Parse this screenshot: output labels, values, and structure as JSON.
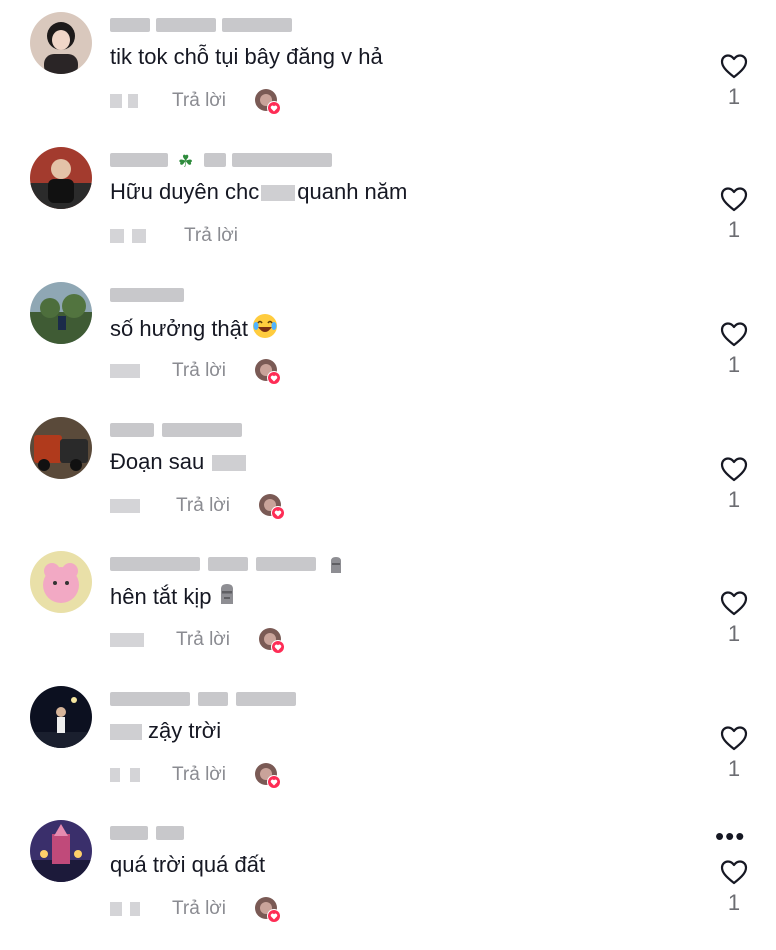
{
  "reply_label": "Trả lời",
  "comments": [
    {
      "text": "tik tok chỗ tụi bây đăng v hả",
      "likes": "1"
    },
    {
      "text_before": "Hữu duyên chc",
      "text_after": "quanh năm",
      "likes": "1"
    },
    {
      "text": "số hưởng thật",
      "likes": "1"
    },
    {
      "text": "Đoạn sau",
      "likes": "1"
    },
    {
      "text": "hên tắt kịp",
      "likes": "1"
    },
    {
      "text": "zậy trời",
      "likes": "1"
    },
    {
      "text": "quá trời quá đất",
      "likes": "1"
    }
  ],
  "colors": {
    "text": "#161823",
    "muted": "#8a8b91",
    "heart_badge": "#fe2c55"
  },
  "icons": [
    "heart-outline-icon",
    "creator-liked-badge-icon",
    "more-options-icon",
    "laughing-emoji-icon",
    "moai-emoji-icon",
    "clover-emoji-icon"
  ]
}
